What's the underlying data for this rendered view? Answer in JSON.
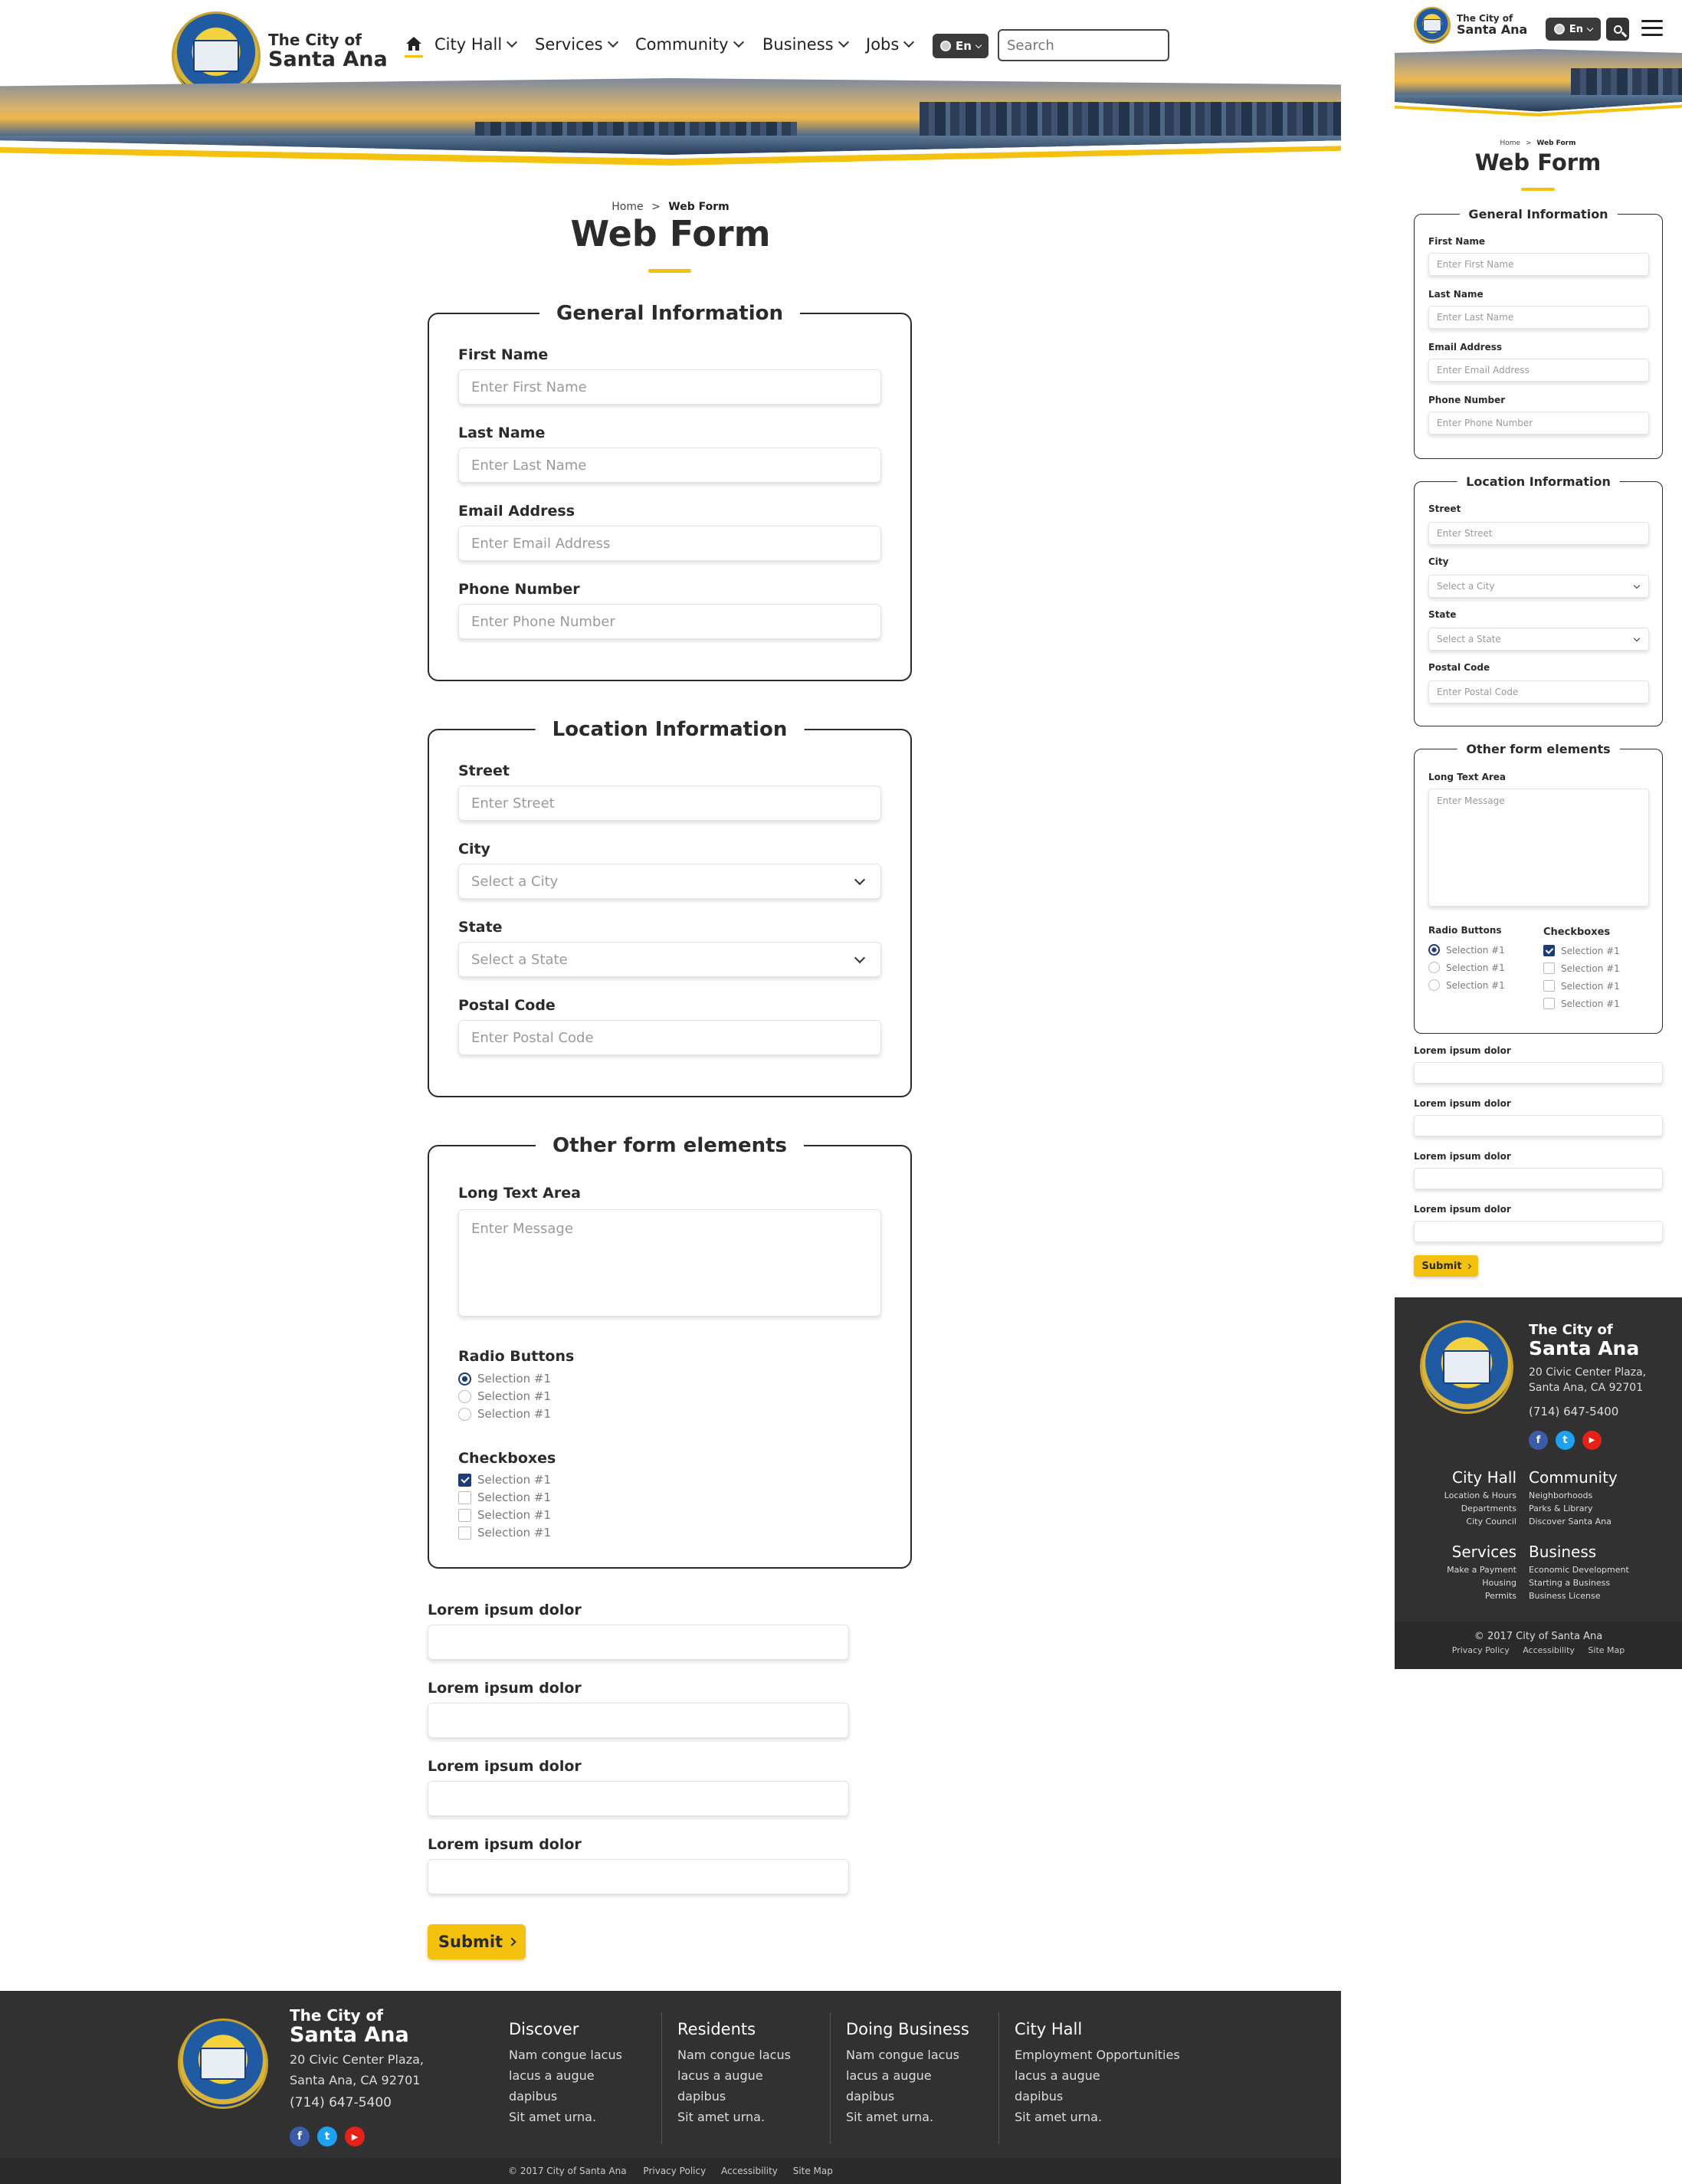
{
  "brand": {
    "line1": "The City of",
    "line2": "Santa Ana"
  },
  "nav": [
    {
      "label": "City Hall"
    },
    {
      "label": "Services"
    },
    {
      "label": "Community"
    },
    {
      "label": "Business"
    },
    {
      "label": "Jobs"
    }
  ],
  "lang": "En",
  "search": {
    "placeholder": "Search"
  },
  "breadcrumb": {
    "home": "Home",
    "sep": ">",
    "current": "Web Form"
  },
  "page_title": "Web Form",
  "general": {
    "legend": "General Information",
    "fields": [
      {
        "label": "First Name",
        "placeholder": "Enter First Name"
      },
      {
        "label": "Last Name",
        "placeholder": "Enter Last Name"
      },
      {
        "label": "Email Address",
        "placeholder": "Enter Email Address"
      },
      {
        "label": "Phone Number",
        "placeholder": "Enter Phone Number"
      }
    ]
  },
  "location": {
    "legend": "Location Information",
    "fields": [
      {
        "label": "Street",
        "placeholder": "Enter Street"
      },
      {
        "label": "City",
        "placeholder": "Select a City"
      },
      {
        "label": "State",
        "placeholder": "Select a State"
      },
      {
        "label": "Postal Code",
        "placeholder": "Enter Postal Code"
      }
    ]
  },
  "other": {
    "legend": "Other form elements",
    "textarea_label": "Long Text Area",
    "textarea_placeholder": "Enter Message",
    "radio_label": "Radio Buttons",
    "radios": [
      "Selection #1",
      "Selection #1",
      "Selection #1"
    ],
    "checkbox_label": "Checkboxes",
    "checkboxes": [
      "Selection #1",
      "Selection #1",
      "Selection #1",
      "Selection #1"
    ]
  },
  "extra_fields": [
    "Lorem ipsum dolor",
    "Lorem ipsum dolor",
    "Lorem ipsum dolor",
    "Lorem ipsum dolor"
  ],
  "submit": "Submit",
  "footer": {
    "addr1": "20 Civic Center Plaza,",
    "addr2": "Santa Ana, CA 92701",
    "phone": "(714) 647-5400",
    "social": {
      "fb": "f",
      "tw": "t",
      "yt": "▶"
    },
    "cols": [
      {
        "title": "Discover",
        "links": [
          "Nam congue lacus",
          "lacus a augue",
          "dapibus",
          "Sit amet urna."
        ]
      },
      {
        "title": "Residents",
        "links": [
          "Nam congue lacus",
          "lacus a augue",
          "dapibus",
          "Sit amet urna."
        ]
      },
      {
        "title": "Doing Business",
        "links": [
          "Nam congue lacus",
          "lacus a augue",
          "dapibus",
          "Sit amet urna."
        ]
      },
      {
        "title": "City Hall",
        "links": [
          "Employment Opportunities",
          "lacus a augue",
          "dapibus",
          "Sit amet urna."
        ]
      }
    ],
    "copyright": "© 2017 City of Santa Ana",
    "links": [
      "Privacy Policy",
      "Accessibility",
      "Site Map"
    ]
  },
  "mobile_footer": {
    "groups": [
      {
        "title": "City Hall",
        "links": [
          "Location & Hours",
          "Departments",
          "City Council"
        ]
      },
      {
        "title": "Community",
        "links": [
          "Neighborhoods",
          "Parks & Library",
          "Discover Santa Ana"
        ]
      },
      {
        "title": "Services",
        "links": [
          "Make a Payment",
          "Housing",
          "Permits"
        ]
      },
      {
        "title": "Business",
        "links": [
          "Economic Development",
          "Starting a Business",
          "Business License"
        ]
      }
    ]
  },
  "colors": {
    "accent": "#f3c10e",
    "dark": "#313131",
    "navy": "#1b3c78"
  }
}
